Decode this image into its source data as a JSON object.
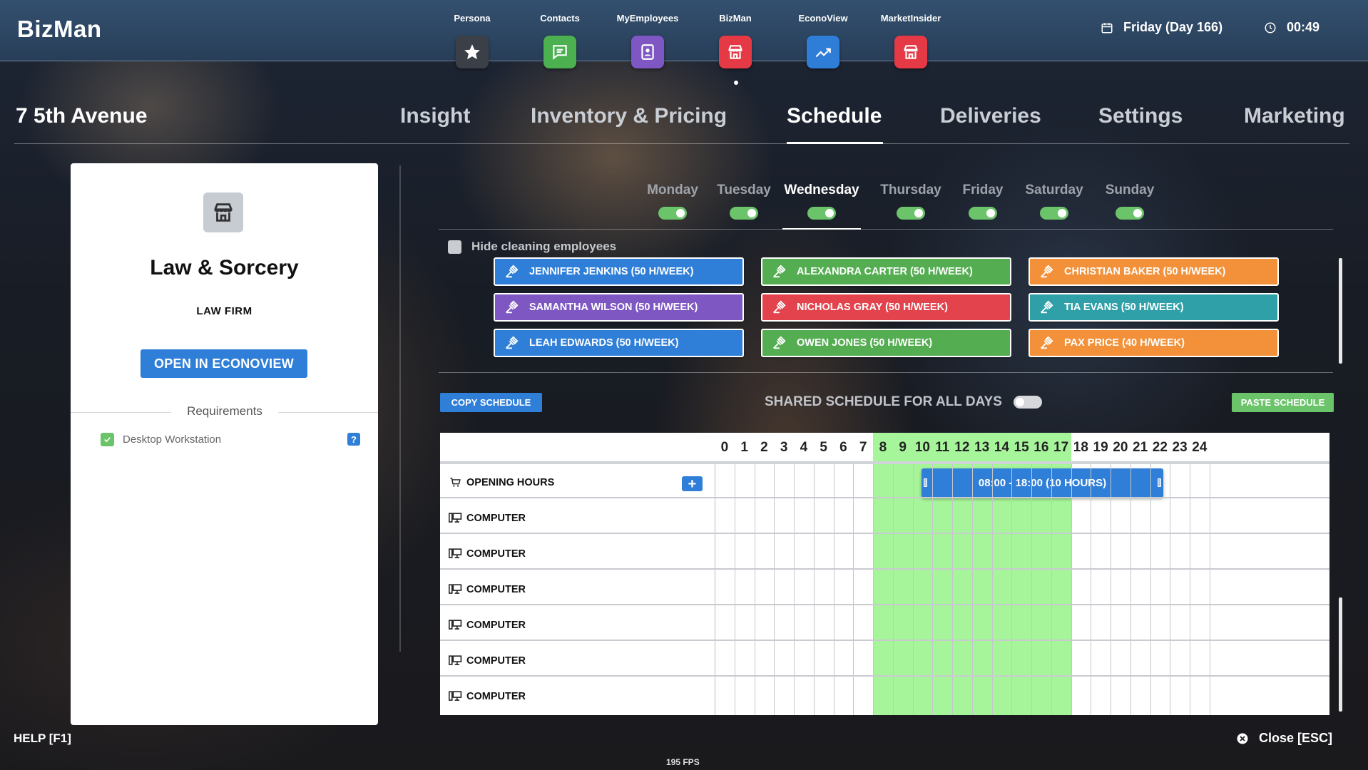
{
  "brand": "BizMan",
  "apps": [
    {
      "label": "Persona",
      "color": "#3b3f47",
      "icon": "star-icon"
    },
    {
      "label": "Contacts",
      "color": "#4caf50",
      "icon": "chat-icon"
    },
    {
      "label": "MyEmployees",
      "color": "#7e57c2",
      "icon": "badge-icon"
    },
    {
      "label": "BizMan",
      "color": "#e53945",
      "icon": "store-icon"
    },
    {
      "label": "EconoView",
      "color": "#2e7dd7",
      "icon": "chart-icon"
    },
    {
      "label": "MarketInsider",
      "color": "#e53945",
      "icon": "store-icon"
    }
  ],
  "status": {
    "day": "Friday (Day 166)",
    "time": "00:49"
  },
  "address": "7 5th Avenue",
  "tabs": [
    "Insight",
    "Inventory & Pricing",
    "Schedule",
    "Deliveries",
    "Settings",
    "Marketing"
  ],
  "active_tab": "Schedule",
  "business": {
    "name": "Law & Sorcery",
    "type": "LAW FIRM",
    "econ_button": "OPEN IN ECONOVIEW",
    "requirements_label": "Requirements",
    "requirements": [
      {
        "label": "Desktop Workstation",
        "met": true,
        "help": "?"
      }
    ]
  },
  "days": [
    "Monday",
    "Tuesday",
    "Wednesday",
    "Thursday",
    "Friday",
    "Saturday",
    "Sunday"
  ],
  "active_day": "Wednesday",
  "hide_cleaning_label": "Hide cleaning employees",
  "employees": [
    {
      "name": "JENNIFER JENKINS (50 H/WEEK)",
      "color": "#2f7fd8"
    },
    {
      "name": "ALEXANDRA CARTER (50 H/WEEK)",
      "color": "#55ad52"
    },
    {
      "name": "CHRISTIAN BAKER (50 H/WEEK)",
      "color": "#f2913a"
    },
    {
      "name": "SAMANTHA WILSON (50 H/WEEK)",
      "color": "#7e57c2"
    },
    {
      "name": "NICHOLAS GRAY (50 H/WEEK)",
      "color": "#e2434d"
    },
    {
      "name": "TIA EVANS (50 H/WEEK)",
      "color": "#2fa0a8"
    },
    {
      "name": "LEAH EDWARDS (50 H/WEEK)",
      "color": "#2f7fd8"
    },
    {
      "name": "OWEN JONES (50 H/WEEK)",
      "color": "#55ad52"
    },
    {
      "name": "PAX PRICE (40 H/WEEK)",
      "color": "#f2913a"
    }
  ],
  "controls": {
    "copy": "COPY SCHEDULE",
    "shared": "SHARED SCHEDULE FOR ALL DAYS",
    "paste": "PASTE SCHEDULE"
  },
  "hours": [
    "0",
    "1",
    "2",
    "3",
    "4",
    "5",
    "6",
    "7",
    "8",
    "9",
    "10",
    "11",
    "12",
    "13",
    "14",
    "15",
    "16",
    "17",
    "18",
    "19",
    "20",
    "21",
    "22",
    "23",
    "24"
  ],
  "opening": {
    "label": "OPENING HOURS",
    "start": 8,
    "end": 18,
    "text": "08:00 - 18:00 (10 HOURS)",
    "highlight_color": "#a6f59b"
  },
  "rows": [
    "COMPUTER",
    "COMPUTER",
    "COMPUTER",
    "COMPUTER",
    "COMPUTER",
    "COMPUTER"
  ],
  "footer": {
    "help": "HELP [F1]",
    "fps": "195 FPS",
    "close": "Close [ESC]"
  }
}
